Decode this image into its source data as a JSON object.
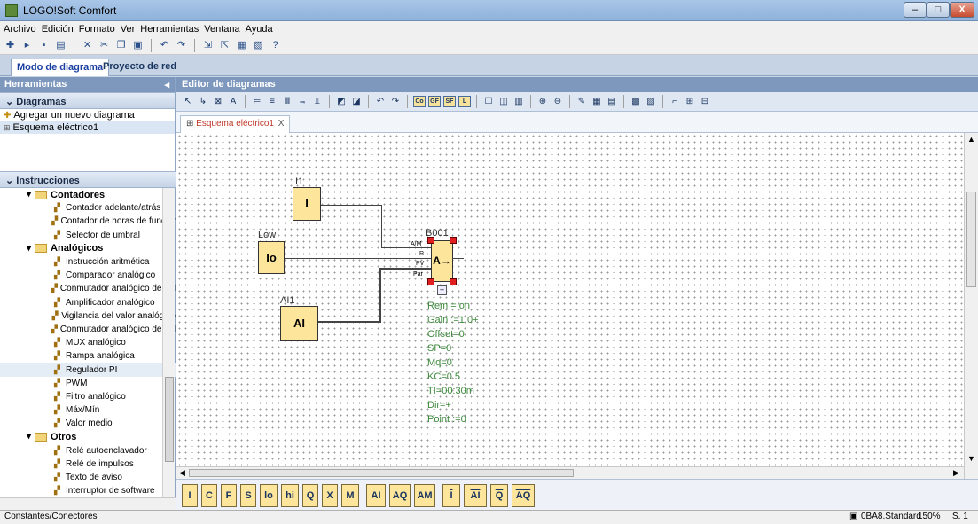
{
  "window": {
    "title": "LOGO!Soft Comfort",
    "min": "–",
    "max": "□",
    "close": "X"
  },
  "menu": [
    "Archivo",
    "Edición",
    "Formato",
    "Ver",
    "Herramientas",
    "Ventana",
    "Ayuda"
  ],
  "modes": {
    "diagram": "Modo de diagrama",
    "network": "Proyecto de red"
  },
  "left": {
    "header": "Herramientas",
    "diagrams_header": "Diagramas",
    "add_diagram": "Agregar un nuevo diagrama",
    "diagram_name": "Esquema eléctrico1",
    "instructions_header": "Instrucciones",
    "tree": [
      {
        "type": "group",
        "label": "Contadores"
      },
      {
        "type": "item",
        "label": "Contador adelante/atrás",
        "icon": "counter-icon"
      },
      {
        "type": "item",
        "label": "Contador de horas de funcior",
        "icon": "counter-icon"
      },
      {
        "type": "item",
        "label": "Selector de umbral",
        "icon": "counter-icon"
      },
      {
        "type": "group",
        "label": "Analógicos"
      },
      {
        "type": "item",
        "label": "Instrucción aritmética",
        "icon": "analog-icon"
      },
      {
        "type": "item",
        "label": "Comparador analógico",
        "icon": "analog-icon"
      },
      {
        "type": "item",
        "label": "Conmutador analógico de val",
        "icon": "analog-icon"
      },
      {
        "type": "item",
        "label": "Amplificador analógico",
        "icon": "analog-icon"
      },
      {
        "type": "item",
        "label": "Vigilancia del valor analógico",
        "icon": "analog-icon"
      },
      {
        "type": "item",
        "label": "Conmutador analógico de val",
        "icon": "analog-icon"
      },
      {
        "type": "item",
        "label": "MUX analógico",
        "icon": "analog-icon"
      },
      {
        "type": "item",
        "label": "Rampa analógica",
        "icon": "analog-icon"
      },
      {
        "type": "item",
        "label": "Regulador PI",
        "icon": "analog-icon",
        "selected": true
      },
      {
        "type": "item",
        "label": "PWM",
        "icon": "analog-icon"
      },
      {
        "type": "item",
        "label": "Filtro analógico",
        "icon": "analog-icon"
      },
      {
        "type": "item",
        "label": "Máx/Mín",
        "icon": "analog-icon"
      },
      {
        "type": "item",
        "label": "Valor medio",
        "icon": "analog-icon"
      },
      {
        "type": "group",
        "label": "Otros"
      },
      {
        "type": "item",
        "label": "Relé autoenclavador",
        "icon": "relay-icon"
      },
      {
        "type": "item",
        "label": "Relé de impulsos",
        "icon": "relay-icon"
      },
      {
        "type": "item",
        "label": "Texto de aviso",
        "icon": "relay-icon"
      },
      {
        "type": "item",
        "label": "Interruptor de software",
        "icon": "relay-icon"
      }
    ]
  },
  "editor": {
    "header": "Editor de diagramas",
    "tab": "Esquema eléctrico1",
    "tab_close": "X",
    "toolbar_boxes": [
      "Co",
      "GF",
      "SF",
      "L"
    ]
  },
  "diagram": {
    "blocks": {
      "i1": {
        "label": "I1",
        "symbol": "I"
      },
      "low": {
        "label": "Low",
        "symbol": "Io"
      },
      "ai1": {
        "label": "AI1",
        "symbol": "AI"
      },
      "b001": {
        "label": "B001",
        "symbol": "A→",
        "pins": [
          "A/M",
          "R",
          "PV",
          "Par"
        ],
        "expand": "+"
      }
    },
    "params": [
      "Rem = on",
      "Gain :=1.0+",
      "Offset=0",
      "SP=0",
      "Mq=0",
      "KC=0.5",
      "TI=00:30m",
      "Dir=+",
      "Point :=0"
    ]
  },
  "palette": [
    "I",
    "C",
    "F",
    "S",
    "lo",
    "hi",
    "Q",
    "X",
    "M",
    "AI",
    "AQ",
    "AM",
    "I",
    "AI",
    "Q",
    "AQ"
  ],
  "status": {
    "left": "Constantes/Conectores",
    "device": "0BA8.Standard",
    "zoom": "150%",
    "page": "S. 1"
  },
  "colors": {
    "block_fill": "#fde59b",
    "header": "#7d97bd",
    "param_text": "#3c8a3c",
    "handle": "#e02020"
  }
}
